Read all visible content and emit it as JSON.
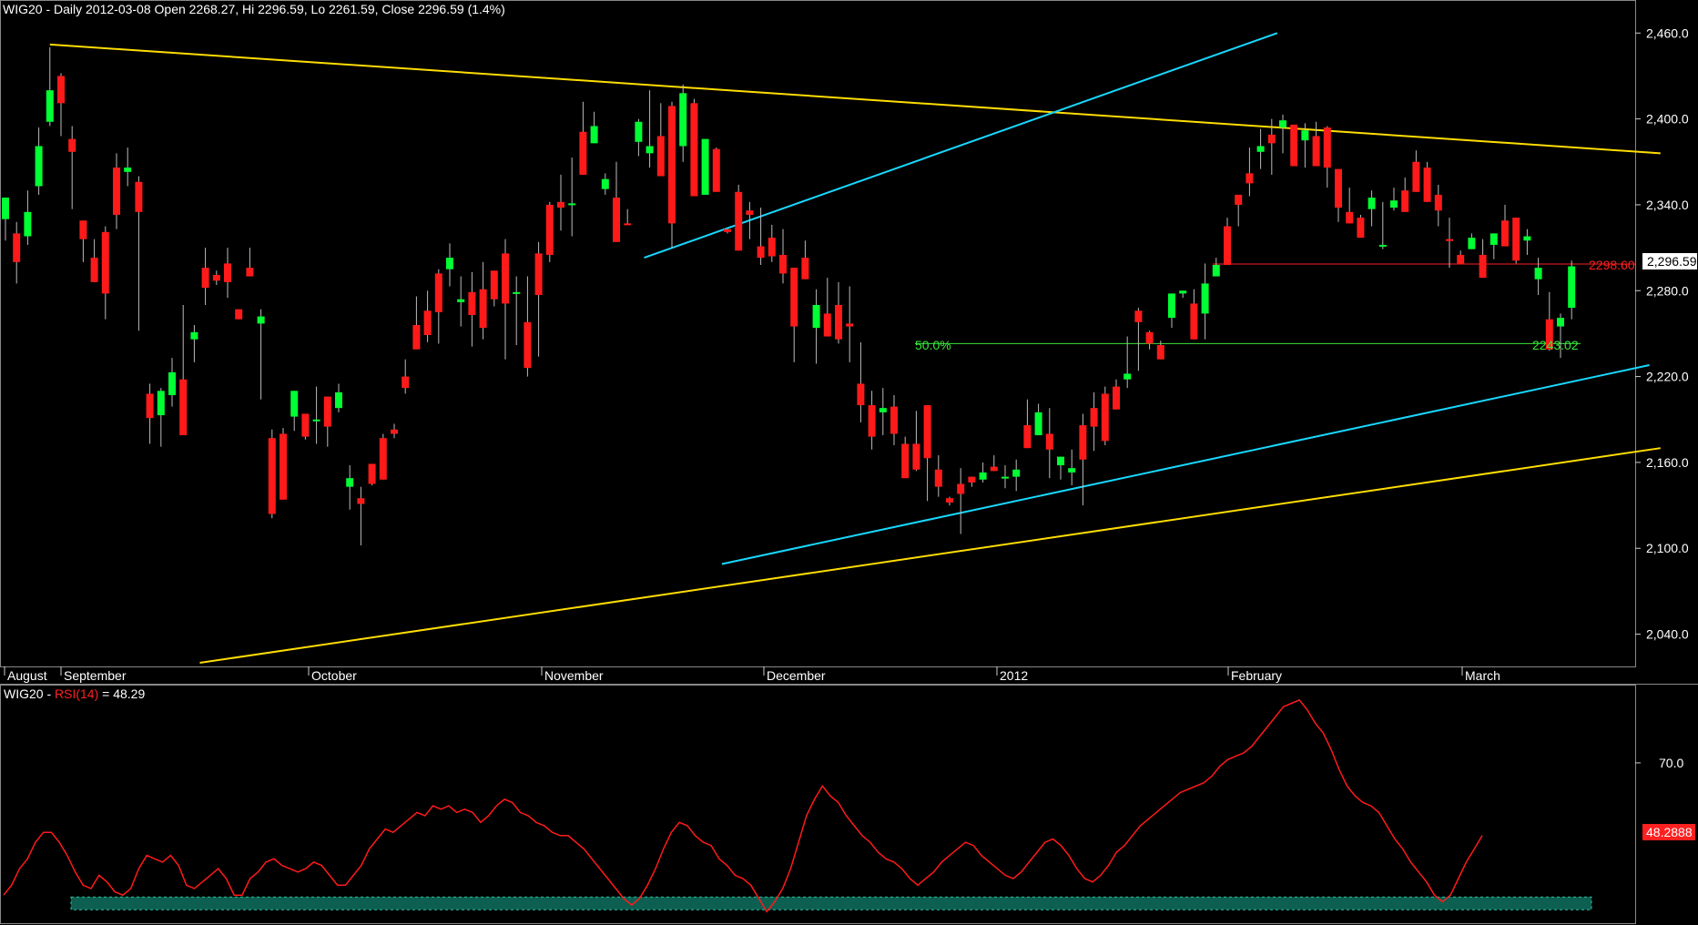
{
  "chart_data": [
    {
      "type": "candlestick",
      "header": "WIG20 - Daily 2012-03-08 Open 2268.27, Hi 2296.59, Lo 2261.59, Close 2296.59 (1.4%)",
      "y_ticks": [
        "2,460.0",
        "2,400.0",
        "2,340.0",
        "2,280.0",
        "2,220.0",
        "2,160.0",
        "2,100.0",
        "2,040.0"
      ],
      "ylim": [
        2020,
        2478
      ],
      "x_labels": [
        "August",
        "September",
        "October",
        "November",
        "December",
        "2012",
        "February",
        "March"
      ],
      "last_price_label": "2,296.59",
      "hline_label": "2298.60",
      "hline_value": 2298.6,
      "fib_label": "50.0%",
      "fib_value_label": "2243.02",
      "fib_value": 2243.02,
      "up_color": "#00ff33",
      "down_color": "#ff1a1a",
      "trendline_color": "#ffdd00",
      "channel_color": "#18d8ff",
      "candles": [
        [
          2330,
          2345,
          2320,
          2315
        ],
        [
          2320,
          2300,
          2285,
          2328
        ],
        [
          2318,
          2335,
          2312,
          2350
        ],
        [
          2353,
          2381,
          2347,
          2394
        ],
        [
          2398,
          2420,
          2395,
          2450
        ],
        [
          2430,
          2411,
          2388,
          2432
        ],
        [
          2386,
          2377,
          2337,
          2395
        ],
        [
          2329,
          2316,
          2300,
          2310
        ],
        [
          2303,
          2286,
          2297,
          2316
        ],
        [
          2321,
          2278,
          2260,
          2325
        ],
        [
          2366,
          2333,
          2323,
          2376
        ],
        [
          2363,
          2366,
          2353,
          2380
        ],
        [
          2356,
          2335,
          2252,
          2360
        ],
        [
          2208,
          2191,
          2173,
          2215
        ],
        [
          2193,
          2210,
          2171,
          2212
        ],
        [
          2207,
          2223,
          2199,
          2233
        ],
        [
          2218,
          2179,
          2180,
          2270
        ],
        [
          2246,
          2251,
          2256,
          2230
        ],
        [
          2296,
          2282,
          2270,
          2310
        ],
        [
          2291,
          2287,
          2284,
          2294
        ],
        [
          2299,
          2286,
          2275,
          2310
        ],
        [
          2267,
          2260,
          2266,
          2263
        ],
        [
          2296,
          2290,
          2295,
          2310
        ],
        [
          2257,
          2262,
          2204,
          2267
        ],
        [
          2177,
          2124,
          2121,
          2183
        ],
        [
          2180,
          2134,
          2140,
          2184
        ],
        [
          2192,
          2210,
          2182,
          2203
        ],
        [
          2194,
          2178,
          2176,
          2184
        ],
        [
          2189,
          2190,
          2173,
          2213
        ],
        [
          2206,
          2185,
          2171,
          2199
        ],
        [
          2198,
          2209,
          2195,
          2215
        ],
        [
          2143,
          2149,
          2127,
          2158
        ],
        [
          2135,
          2131,
          2102,
          2143
        ],
        [
          2159,
          2145,
          2144,
          2149
        ],
        [
          2177,
          2148,
          2160,
          2180
        ],
        [
          2183,
          2180,
          2177,
          2187
        ],
        [
          2220,
          2212,
          2208,
          2232
        ],
        [
          2256,
          2239,
          2247,
          2276
        ],
        [
          2266,
          2249,
          2244,
          2280
        ],
        [
          2292,
          2265,
          2243,
          2295
        ],
        [
          2295,
          2303,
          2283,
          2313
        ],
        [
          2272,
          2274,
          2255,
          2290
        ],
        [
          2279,
          2263,
          2241,
          2293
        ],
        [
          2281,
          2254,
          2246,
          2300
        ],
        [
          2294,
          2274,
          2269,
          2280
        ],
        [
          2306,
          2271,
          2232,
          2316
        ],
        [
          2279,
          2279,
          2242,
          2290
        ],
        [
          2258,
          2226,
          2220,
          2290
        ],
        [
          2306,
          2277,
          2234,
          2314
        ],
        [
          2340,
          2305,
          2300,
          2342
        ],
        [
          2342,
          2338,
          2322,
          2361
        ],
        [
          2340,
          2341,
          2318,
          2373
        ],
        [
          2391,
          2361,
          2376,
          2412
        ],
        [
          2383,
          2395,
          2389,
          2405
        ],
        [
          2351,
          2358,
          2362,
          2347
        ],
        [
          2345,
          2314,
          2341,
          2370
        ],
        [
          2327,
          2326,
          2336,
          2337
        ],
        [
          2384,
          2398,
          2374,
          2400
        ],
        [
          2376,
          2381,
          2366,
          2420
        ],
        [
          2388,
          2360,
          2360,
          2411
        ],
        [
          2409,
          2327,
          2310,
          2412
        ],
        [
          2381,
          2418,
          2370,
          2424
        ],
        [
          2411,
          2346,
          2348,
          2414
        ],
        [
          2347,
          2386,
          2361,
          2358
        ],
        [
          2379,
          2349,
          2380,
          2358
        ],
        [
          2323,
          2321,
          2320,
          2320
        ],
        [
          2349,
          2308,
          2308,
          2354
        ],
        [
          2336,
          2333,
          2316,
          2342
        ],
        [
          2311,
          2303,
          2298,
          2338
        ],
        [
          2317,
          2304,
          2300,
          2326
        ],
        [
          2305,
          2292,
          2285,
          2323
        ],
        [
          2296,
          2255,
          2230,
          2290
        ],
        [
          2303,
          2288,
          2290,
          2315
        ],
        [
          2254,
          2270,
          2229,
          2281
        ],
        [
          2264,
          2248,
          2260,
          2289
        ],
        [
          2270,
          2246,
          2243,
          2286
        ],
        [
          2257,
          2255,
          2230,
          2283
        ],
        [
          2215,
          2200,
          2188,
          2244
        ],
        [
          2200,
          2178,
          2169,
          2210
        ],
        [
          2195,
          2198,
          2179,
          2212
        ],
        [
          2199,
          2180,
          2172,
          2207
        ],
        [
          2173,
          2149,
          2160,
          2178
        ],
        [
          2173,
          2155,
          2154,
          2196
        ],
        [
          2200,
          2163,
          2133,
          2187
        ],
        [
          2155,
          2143,
          2136,
          2165
        ],
        [
          2135,
          2132,
          2130,
          2136
        ],
        [
          2145,
          2138,
          2110,
          2156
        ],
        [
          2150,
          2146,
          2143,
          2147
        ],
        [
          2148,
          2153,
          2146,
          2160
        ],
        [
          2157,
          2154,
          2161,
          2165
        ],
        [
          2149,
          2150,
          2142,
          2158
        ],
        [
          2150,
          2155,
          2140,
          2162
        ],
        [
          2186,
          2170,
          2172,
          2204
        ],
        [
          2179,
          2195,
          2179,
          2201
        ],
        [
          2180,
          2169,
          2149,
          2198
        ],
        [
          2158,
          2164,
          2148,
          2162
        ],
        [
          2153,
          2156,
          2144,
          2169
        ],
        [
          2186,
          2162,
          2130,
          2194
        ],
        [
          2198,
          2185,
          2168,
          2209
        ],
        [
          2208,
          2175,
          2172,
          2213
        ],
        [
          2213,
          2197,
          2207,
          2218
        ],
        [
          2218,
          2222,
          2212,
          2248
        ],
        [
          2266,
          2258,
          2224,
          2268
        ],
        [
          2251,
          2243,
          2239,
          2252
        ],
        [
          2242,
          2232,
          2235,
          2245
        ],
        [
          2261,
          2278,
          2254,
          2266
        ],
        [
          2278,
          2280,
          2276,
          2275
        ],
        [
          2271,
          2246,
          2264,
          2281
        ],
        [
          2264,
          2285,
          2246,
          2299
        ],
        [
          2290,
          2298,
          2303,
          2294
        ],
        [
          2325,
          2298,
          2306,
          2331
        ],
        [
          2347,
          2340,
          2325,
          2341
        ],
        [
          2362,
          2355,
          2346,
          2380
        ],
        [
          2377,
          2381,
          2365,
          2393
        ],
        [
          2389,
          2383,
          2361,
          2400
        ],
        [
          2394,
          2399,
          2376,
          2403
        ],
        [
          2396,
          2367,
          2373,
          2386
        ],
        [
          2385,
          2392,
          2366,
          2397
        ],
        [
          2388,
          2367,
          2372,
          2398
        ],
        [
          2394,
          2366,
          2352,
          2395
        ],
        [
          2365,
          2338,
          2328,
          2345
        ],
        [
          2335,
          2327,
          2329,
          2352
        ],
        [
          2331,
          2317,
          2325,
          2333
        ],
        [
          2337,
          2345,
          2325,
          2350
        ],
        [
          2311,
          2312,
          2309,
          2342
        ],
        [
          2338,
          2343,
          2336,
          2352
        ],
        [
          2350,
          2335,
          2352,
          2359
        ],
        [
          2370,
          2349,
          2352,
          2378
        ],
        [
          2366,
          2342,
          2370,
          2362
        ],
        [
          2347,
          2336,
          2325,
          2354
        ],
        [
          2316,
          2315,
          2296,
          2331
        ],
        [
          2305,
          2299,
          2305,
          2308
        ],
        [
          2309,
          2317,
          2318,
          2320
        ],
        [
          2305,
          2289,
          2290,
          2316
        ],
        [
          2312,
          2320,
          2302,
          2311
        ],
        [
          2329,
          2311,
          2320,
          2340
        ],
        [
          2331,
          2301,
          2299,
          2327
        ],
        [
          2315,
          2318,
          2305,
          2323
        ],
        [
          2288,
          2296,
          2277,
          2303
        ],
        [
          2260,
          2239,
          2238,
          2279
        ],
        [
          2255,
          2261,
          2233,
          2264
        ],
        [
          2268,
          2297,
          2260,
          2301
        ]
      ],
      "rsi_header": "WIG20 - RSI(14) = 48.29",
      "rsi_ticks": [
        "70.0"
      ],
      "rsi_ylim": [
        24,
        92
      ],
      "rsi_value_label": "48.2888",
      "rsi_band_color": "#0d5f52",
      "rsi": [
        30,
        33,
        38,
        41,
        46,
        49,
        49,
        46,
        42,
        37,
        33,
        32,
        36,
        34,
        31,
        30,
        32,
        38,
        42,
        41,
        40,
        42,
        39,
        33,
        32,
        34,
        36,
        38,
        35,
        30,
        30,
        35,
        37,
        40,
        41,
        39,
        38,
        37,
        38,
        40,
        39,
        36,
        33,
        33,
        36,
        39,
        44,
        47,
        50,
        49,
        51,
        53,
        55,
        54,
        57,
        56,
        57,
        55,
        56,
        55,
        52,
        54,
        57,
        59,
        58,
        55,
        54,
        52,
        51,
        49,
        48,
        48,
        46,
        44,
        41,
        38,
        35,
        32,
        29,
        27,
        29,
        33,
        38,
        44,
        49,
        52,
        51,
        48,
        46,
        45,
        41,
        39,
        36,
        35,
        33,
        29,
        25,
        28,
        32,
        38,
        46,
        54,
        59,
        63,
        60,
        58,
        54,
        51,
        48,
        46,
        43,
        41,
        40,
        38,
        35,
        33,
        35,
        37,
        40,
        42,
        44,
        46,
        45,
        42,
        40,
        38,
        36,
        35,
        37,
        40,
        43,
        46,
        47,
        45,
        42,
        38,
        35,
        34,
        36,
        39,
        43,
        45,
        48,
        51,
        53,
        55,
        57,
        59,
        61,
        62,
        63,
        64,
        66,
        69,
        71,
        72,
        73,
        75,
        78,
        81,
        84,
        87,
        88,
        89,
        86,
        82,
        79,
        74,
        68,
        63,
        60,
        58,
        57,
        55,
        51,
        47,
        44,
        40,
        37,
        34,
        30,
        28,
        30,
        35,
        40,
        44,
        48
      ]
    }
  ]
}
